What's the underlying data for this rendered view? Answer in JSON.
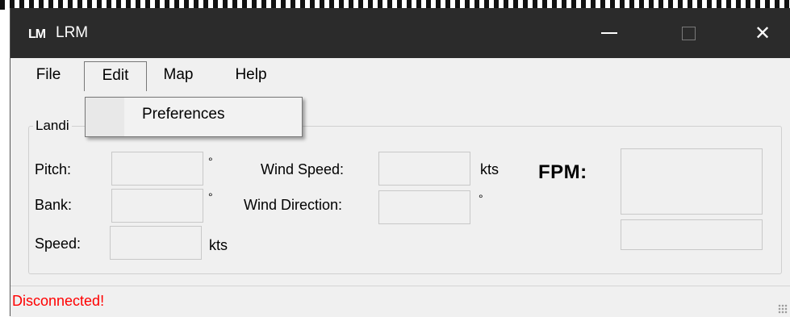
{
  "window": {
    "icon_text": "LM",
    "title": "LRM",
    "close_glyph": "✕"
  },
  "menu": {
    "file": "File",
    "edit": "Edit",
    "map": "Map",
    "help": "Help"
  },
  "dropdown": {
    "preferences": "Preferences"
  },
  "group": {
    "legend": "Landi"
  },
  "fields": {
    "pitch_label": "Pitch:",
    "bank_label": "Bank:",
    "speed_label": "Speed:",
    "wind_speed_label": "Wind Speed:",
    "wind_direction_label": "Wind Direction:",
    "degree": "°",
    "kts": "kts",
    "fpm_label": "FPM:"
  },
  "status": {
    "text": "Disconnected!",
    "color": "#ff0000"
  }
}
